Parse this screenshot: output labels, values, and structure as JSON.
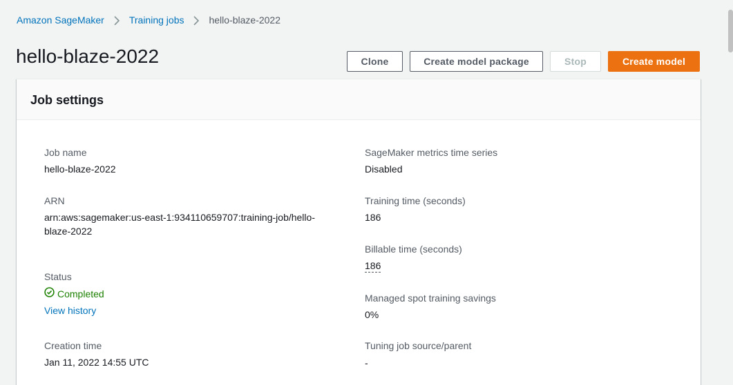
{
  "breadcrumb": {
    "items": [
      "Amazon SageMaker",
      "Training jobs"
    ],
    "current": "hello-blaze-2022"
  },
  "page": {
    "title": "hello-blaze-2022"
  },
  "actions": {
    "clone": "Clone",
    "create_model_package": "Create model package",
    "stop": "Stop",
    "create_model": "Create model"
  },
  "colors": {
    "link": "#0073bb",
    "primary": "#ec7211",
    "success": "#1d8102",
    "background": "#f2f3f3"
  },
  "job_settings": {
    "title": "Job settings",
    "job_name": {
      "label": "Job name",
      "value": "hello-blaze-2022"
    },
    "arn": {
      "label": "ARN",
      "value": "arn:aws:sagemaker:us-east-1:934110659707:training-job/hello-blaze-2022"
    },
    "status": {
      "label": "Status",
      "value": "Completed",
      "icon": "check-circle-icon",
      "history_link": "View history"
    },
    "creation_time": {
      "label": "Creation time",
      "value": "Jan 11, 2022 14:55 UTC"
    },
    "metrics_time_series": {
      "label": "SageMaker metrics time series",
      "value": "Disabled"
    },
    "training_time": {
      "label": "Training time (seconds)",
      "value": "186"
    },
    "billable_time": {
      "label": "Billable time (seconds)",
      "value": "186"
    },
    "spot_savings": {
      "label": "Managed spot training savings",
      "value": "0%"
    },
    "tuning_parent": {
      "label": "Tuning job source/parent",
      "value": "-"
    }
  }
}
